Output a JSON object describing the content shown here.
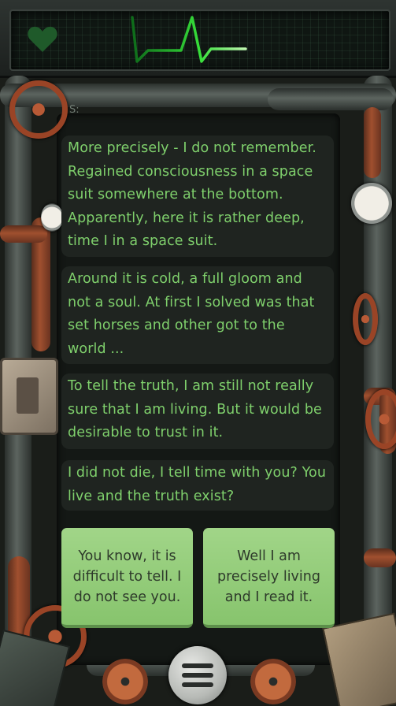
{
  "monitor": {
    "heart_icon": "heart-icon",
    "pulse_color": "#2ed12e"
  },
  "status_letter": "S:",
  "messages": [
    {
      "text": "More precisely - I do not remember. Regained consciousness in a space suit somewhere at the bottom. Apparently, here it is rather deep, time I in a space suit."
    },
    {
      "text": "Around it is cold, a full gloom and not a soul. At first I solved was that set horses and other got to the world ..."
    },
    {
      "text": "To tell the truth, I am still not really sure that I am living. But it would be desirable to trust in it."
    },
    {
      "text": "I did not die, I tell time with you? You live and the truth exist?"
    }
  ],
  "choices": [
    {
      "label": "You know, it is difficult to tell. I do not see you."
    },
    {
      "label": "Well I am precisely living and I read it."
    }
  ],
  "colors": {
    "message_text": "#7fd06c",
    "choice_bg": "#94cc7a",
    "choice_text": "#2e3a2b"
  }
}
